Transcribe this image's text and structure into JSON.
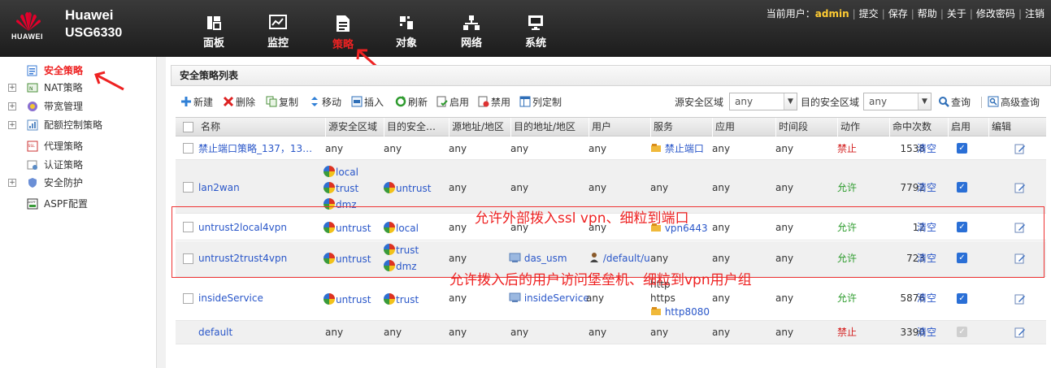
{
  "header": {
    "brand": "Huawei",
    "model": "USG6330",
    "logo_text": "HUAWEI",
    "nav": [
      {
        "label": "面板",
        "icon": "dashboard-icon"
      },
      {
        "label": "监控",
        "icon": "monitor-chart-icon"
      },
      {
        "label": "策略",
        "icon": "policy-document-icon",
        "active": true
      },
      {
        "label": "对象",
        "icon": "object-icon"
      },
      {
        "label": "网络",
        "icon": "network-tree-icon"
      },
      {
        "label": "系统",
        "icon": "system-display-icon"
      }
    ],
    "user_label": "当前用户：",
    "user_name": "admin",
    "links": [
      "提交",
      "保存",
      "帮助",
      "关于",
      "修改密码",
      "注销"
    ]
  },
  "sidebar": {
    "items": [
      {
        "label": "安全策略",
        "icon": "security-policy-icon",
        "active": true,
        "expander": false
      },
      {
        "label": "NAT策略",
        "icon": "nat-icon",
        "expander": true
      },
      {
        "label": "带宽管理",
        "icon": "bandwidth-icon",
        "expander": true
      },
      {
        "label": "配额控制策略",
        "icon": "quota-icon",
        "expander": true
      },
      {
        "label": "代理策略",
        "icon": "ssl-proxy-icon",
        "expander": false
      },
      {
        "label": "认证策略",
        "icon": "auth-icon",
        "expander": false
      },
      {
        "label": "安全防护",
        "icon": "shield-icon",
        "expander": true
      },
      {
        "label": "ASPF配置",
        "icon": "aspf-icon",
        "expander": false
      }
    ]
  },
  "main": {
    "title": "安全策略列表",
    "toolbar": {
      "new": "新建",
      "delete": "删除",
      "copy": "复制",
      "move": "移动",
      "insert": "插入",
      "refresh": "刷新",
      "enable": "启用",
      "disable": "禁用",
      "columns": "列定制",
      "src_zone_label": "源安全区域",
      "src_zone_value": "any",
      "dst_zone_label": "目的安全区域",
      "dst_zone_value": "any",
      "query": "查询",
      "adv_query": "高级查询"
    },
    "columns": [
      "名称",
      "源安全区域",
      "目的安全…",
      "源地址/地区",
      "目的地址/地区",
      "用户",
      "服务",
      "应用",
      "时间段",
      "动作",
      "命中次数",
      "启用",
      "编辑"
    ],
    "clear_label": "清空",
    "rows": [
      {
        "name": "禁止端口策略_137，13…",
        "src_zone": [
          "any"
        ],
        "dst_zone": [
          "any"
        ],
        "src_addr": "any",
        "dst_addr": "any",
        "user": "any",
        "service": [
          "禁止端口"
        ],
        "app": "any",
        "time": "any",
        "action": "禁止",
        "hits": "1538",
        "enabled": true
      },
      {
        "name": "lan2wan",
        "src_zone": [
          "local",
          "trust",
          "dmz"
        ],
        "dst_zone": [
          "untrust"
        ],
        "src_addr": "any",
        "dst_addr": "any",
        "user": "any",
        "service": [
          "any"
        ],
        "app": "any",
        "time": "any",
        "action": "允许",
        "hits": "7792",
        "enabled": true
      },
      {
        "name": "untrust2local4vpn",
        "src_zone": [
          "untrust"
        ],
        "dst_zone": [
          "local"
        ],
        "src_addr": "any",
        "dst_addr": "any",
        "user": "any",
        "service": [
          "vpn6443"
        ],
        "app": "any",
        "time": "any",
        "action": "允许",
        "hits": "12",
        "enabled": true
      },
      {
        "name": "untrust2trust4vpn",
        "src_zone": [
          "untrust"
        ],
        "dst_zone": [
          "trust",
          "dmz"
        ],
        "src_addr": "any",
        "dst_addr": "das_usm",
        "user": "/default/u",
        "service": [
          "any"
        ],
        "app": "any",
        "time": "any",
        "action": "允许",
        "hits": "723",
        "enabled": true
      },
      {
        "name": "insideService",
        "src_zone": [
          "untrust"
        ],
        "dst_zone": [
          "trust"
        ],
        "src_addr": "any",
        "dst_addr": "insideService",
        "user": "any",
        "service": [
          "http",
          "https",
          "http8080"
        ],
        "app": "any",
        "time": "any",
        "action": "允许",
        "hits": "5876",
        "enabled": true
      },
      {
        "name": "default",
        "src_zone": [
          "any"
        ],
        "dst_zone": [
          "any"
        ],
        "src_addr": "any",
        "dst_addr": "any",
        "user": "any",
        "service": [
          "any"
        ],
        "app": "any",
        "time": "any",
        "action": "禁止",
        "hits": "3390",
        "enabled": false
      }
    ]
  },
  "annotations": {
    "note1": "允许外部拨入ssl vpn、细粒到端口",
    "note2": "允许拨入后的用户访问堡垒机、细粒到vpn用户组"
  },
  "colors": {
    "active_red": "#e22222",
    "link_blue": "#2a57c9",
    "allow_green": "#2e9c2e",
    "deny_red": "#d42222"
  }
}
